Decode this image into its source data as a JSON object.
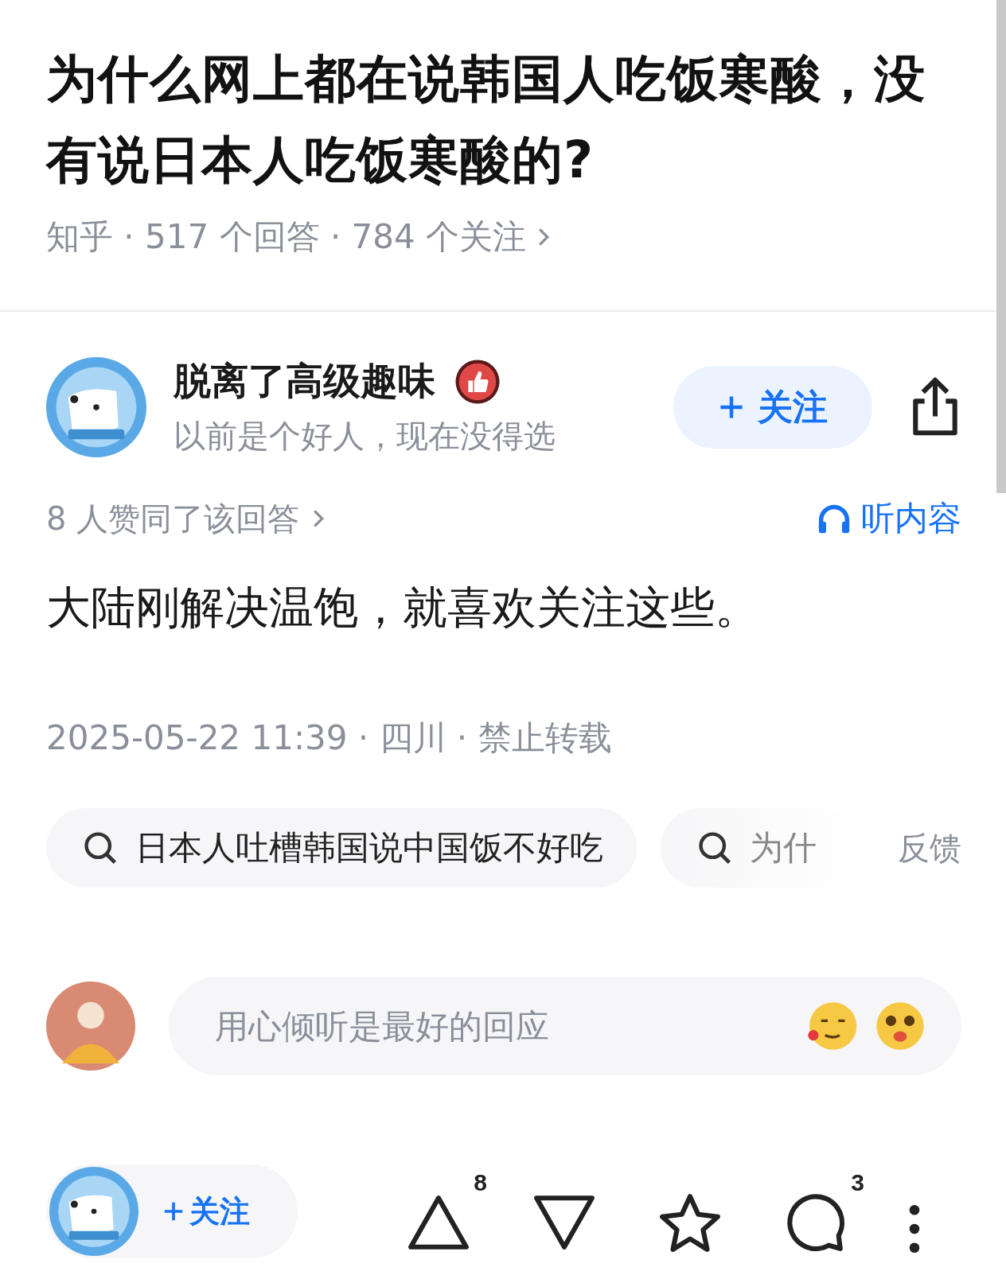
{
  "question": {
    "title": "为什么网上都在说韩国人吃饭寒酸，没有说日本人吃饭寒酸的?",
    "meta": "知乎 · 517 个回答 · 784 个关注"
  },
  "author": {
    "name": "脱离了高级趣味",
    "bio": "以前是个好人，现在没得选",
    "follow_button": "关注"
  },
  "upvote_summary": "8 人赞同了该回答",
  "listen_button": "听内容",
  "answer": "大陆刚解决温饱，就喜欢关注这些。",
  "answer_meta": "2025-05-22 11:39 · 四川 · 禁止转载",
  "related_searches": [
    {
      "text": "日本人吐槽韩国说中国饭不好吃",
      "faded": false
    },
    {
      "text": "为什",
      "faded": true
    }
  ],
  "feedback": "反馈",
  "comment_box": {
    "placeholder": "用心倾听是最好的回应"
  },
  "bottom_bar": {
    "follow_button": "关注",
    "upvote_count": "8",
    "comment_count": "3"
  }
}
